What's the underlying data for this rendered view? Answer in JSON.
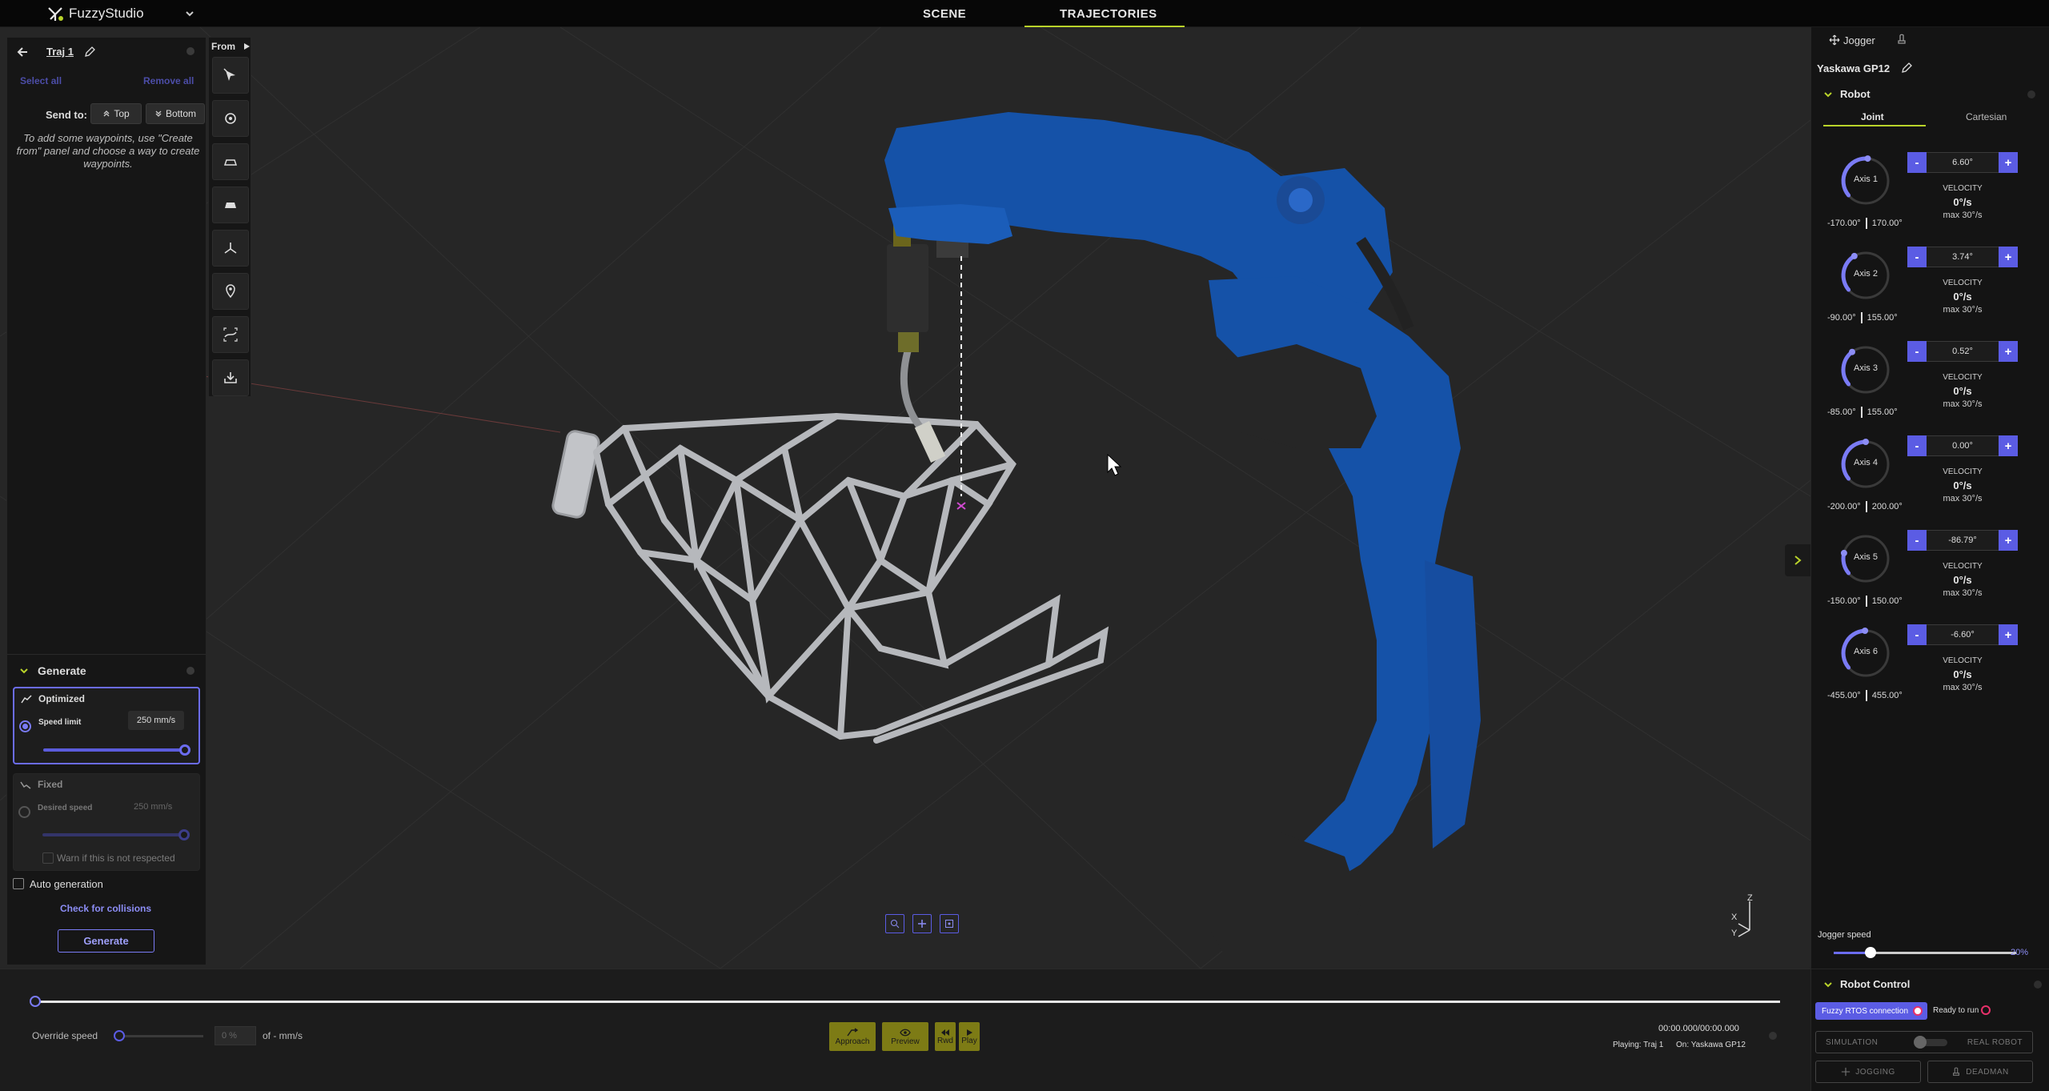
{
  "app": {
    "name": "FuzzyStudio",
    "tabs": [
      {
        "label": "SCENE"
      },
      {
        "label": "TRAJECTORIES"
      }
    ]
  },
  "colors": {
    "accent": "#6b6cf0",
    "tab_underline": "#b9d32a",
    "robot_blue": "#1552a8",
    "action_buttons": "#7d7b15"
  },
  "trajectory_panel": {
    "name": "Traj 1",
    "select_all": "Select all",
    "remove_all": "Remove all",
    "send_to_label": "Send to:",
    "send_top": "Top",
    "send_bottom": "Bottom",
    "hint": "To add some waypoints, use \"Create from\" panel and choose a way to create waypoints."
  },
  "tools": {
    "from_label": "From",
    "items": [
      "cursor-select-icon",
      "target-icon",
      "surface-edge-icon",
      "surface-icon",
      "frame-axes-icon",
      "location-pin-icon",
      "path-scan-icon",
      "import-icon"
    ]
  },
  "generate": {
    "title": "Generate",
    "optimized": {
      "label": "Optimized",
      "speed_limit_label": "Speed limit",
      "speed_limit_value": "250 mm/s",
      "slider_fraction": 1.0
    },
    "fixed": {
      "label": "Fixed",
      "desired_speed_label": "Desired speed",
      "desired_speed_value": "250 mm/s",
      "warn_label": "Warn if this is not respected",
      "slider_fraction": 1.0
    },
    "auto_generation": "Auto generation",
    "check_collisions": "Check for collisions",
    "generate_button": "Generate"
  },
  "viewport": {
    "axis_gizmo": {
      "x": "X",
      "y": "Y",
      "z": "Z"
    }
  },
  "jogger": {
    "tab_label": "Jogger",
    "robot_name": "Yaskawa GP12",
    "section": "Robot",
    "mode_tabs": [
      "Joint",
      "Cartesian"
    ],
    "velocity_label": "VELOCITY",
    "axes": [
      {
        "name": "Axis 1",
        "value": "6.60°",
        "min": "-170.00°",
        "max": "170.00°",
        "velocity": "0°/s",
        "max_velocity": "max 30°/s"
      },
      {
        "name": "Axis 2",
        "value": "3.74°",
        "min": "-90.00°",
        "max": "155.00°",
        "velocity": "0°/s",
        "max_velocity": "max 30°/s"
      },
      {
        "name": "Axis 3",
        "value": "0.52°",
        "min": "-85.00°",
        "max": "155.00°",
        "velocity": "0°/s",
        "max_velocity": "max 30°/s"
      },
      {
        "name": "Axis 4",
        "value": "0.00°",
        "min": "-200.00°",
        "max": "200.00°",
        "velocity": "0°/s",
        "max_velocity": "max 30°/s"
      },
      {
        "name": "Axis 5",
        "value": "-86.79°",
        "min": "-150.00°",
        "max": "150.00°",
        "velocity": "0°/s",
        "max_velocity": "max 30°/s"
      },
      {
        "name": "Axis 6",
        "value": "-6.60°",
        "min": "-455.00°",
        "max": "455.00°",
        "velocity": "0°/s",
        "max_velocity": "max 30°/s"
      }
    ],
    "jogger_speed_label": "Jogger speed",
    "jogger_speed_value": "20",
    "jogger_speed_unit": "%"
  },
  "timeline": {
    "override_label": "Override speed",
    "override_value": "0 %",
    "speed_readout": "of - mm/s",
    "buttons": [
      "Approach",
      "Preview",
      "Rwd",
      "Play"
    ],
    "time": "00:00.000/00:00.000",
    "playing": "Playing: Traj 1",
    "on": "On: Yaskawa GP12"
  },
  "robot_control": {
    "title": "Robot Control",
    "connection": "Fuzzy RTOS connection",
    "ready": "Ready to run",
    "simulation": "SIMULATION",
    "real_robot": "REAL ROBOT",
    "jogging": "JOGGING",
    "deadman": "DEADMAN"
  }
}
